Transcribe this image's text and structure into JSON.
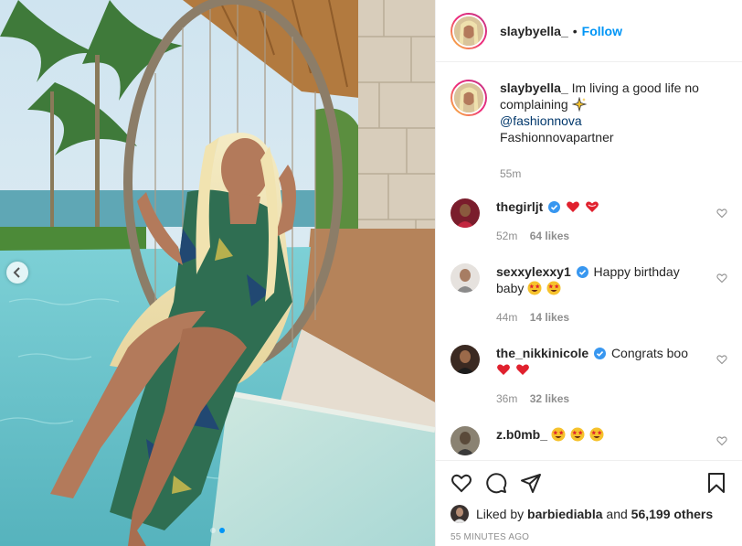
{
  "header": {
    "username": "slaybyella_",
    "separator": "•",
    "follow_label": "Follow"
  },
  "caption": {
    "username": "slaybyella_",
    "text": "Im living a good life no complaining",
    "mention": "@fashionnova",
    "tag_line": "Fashionnovapartner",
    "time": "55m"
  },
  "comments": [
    {
      "username": "thegirljt",
      "verified": true,
      "text": "",
      "emoji": [
        "red-heart",
        "heart-outline"
      ],
      "time": "52m",
      "likes": "64 likes"
    },
    {
      "username": "sexxylexxy1",
      "verified": true,
      "text": "Happy birthday baby",
      "emoji": [
        "star-eyes",
        "star-eyes"
      ],
      "time": "44m",
      "likes": "14 likes"
    },
    {
      "username": "the_nikkinicole",
      "verified": true,
      "text": "Congrats boo",
      "emoji": [
        "red-heart",
        "red-heart"
      ],
      "time": "36m",
      "likes": "32 likes"
    },
    {
      "username": "z.b0mb_",
      "verified": false,
      "text": "",
      "emoji": [
        "star-eyes",
        "star-eyes",
        "star-eyes"
      ],
      "time": "",
      "likes": ""
    }
  ],
  "actions": {
    "liked_prefix": "Liked by",
    "liked_user": "barbiediabla",
    "liked_and": "and",
    "liked_count": "56,199 others",
    "timestamp": "55 MINUTES AGO"
  },
  "carousel": {
    "total": 2,
    "current": 2
  },
  "colors": {
    "link": "#0095f6",
    "mention": "#00376b",
    "muted": "#8e8e8e",
    "verified": "#3897f0"
  }
}
